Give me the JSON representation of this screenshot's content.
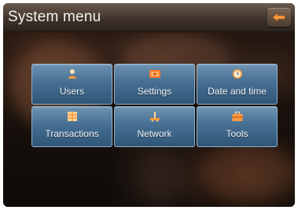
{
  "header": {
    "title": "System menu",
    "back_icon": "back-arrow-icon"
  },
  "menu": {
    "items": [
      {
        "label": "Users",
        "icon": "user-icon"
      },
      {
        "label": "Settings",
        "icon": "settings-icon"
      },
      {
        "label": "Date and time",
        "icon": "clock-icon"
      },
      {
        "label": "Transactions",
        "icon": "transactions-icon"
      },
      {
        "label": "Network",
        "icon": "network-icon"
      },
      {
        "label": "Tools",
        "icon": "toolbox-icon"
      }
    ]
  },
  "colors": {
    "tile_top": "#6e93b1",
    "tile_bottom": "#2f5677",
    "icon_orange": "#ff9a3c",
    "title_text": "#f4f2ef"
  }
}
